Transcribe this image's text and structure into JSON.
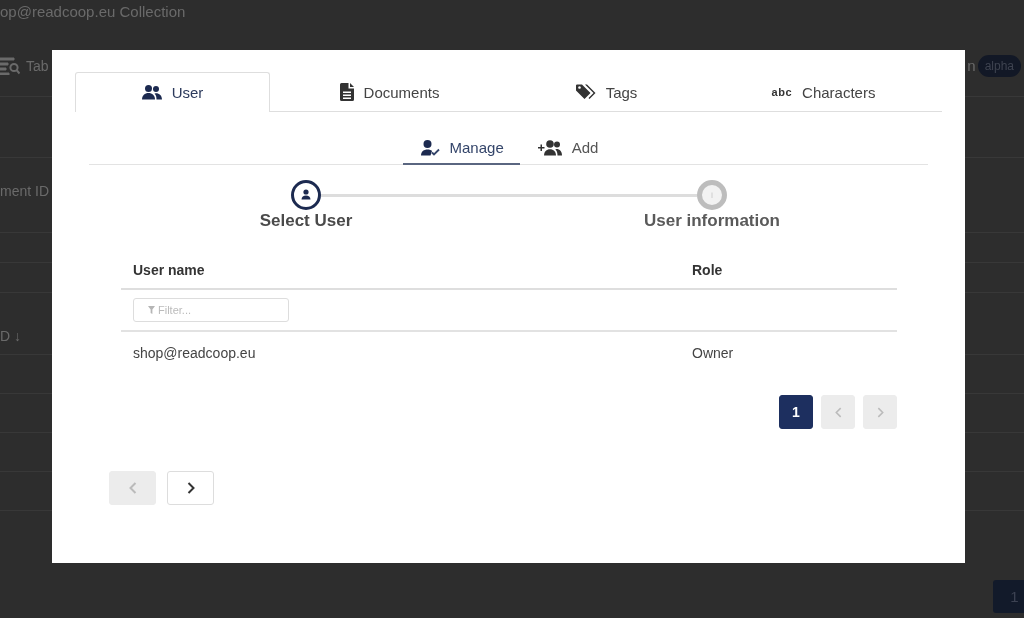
{
  "background": {
    "title": "op@readcoop.eu Collection",
    "toolbar_label": "Tab",
    "badge_caption": "n",
    "badge": "alpha",
    "labels": [
      "ment ID",
      "D ↓"
    ],
    "page_button": {
      "label": "1",
      "selected": true
    }
  },
  "dialog": {
    "tabs": [
      {
        "label": "User",
        "selected": true
      },
      {
        "label": "Documents",
        "selected": false
      },
      {
        "label": "Tags",
        "selected": false
      },
      {
        "label": "Characters",
        "glyph": "abc",
        "selected": false
      }
    ],
    "subtabs": [
      {
        "label": "Manage",
        "selected": true
      },
      {
        "label": "Add",
        "selected": false
      }
    ],
    "steps": [
      {
        "label": "Select User",
        "active": true
      },
      {
        "label": "User information",
        "active": false
      }
    ],
    "table": {
      "columns": [
        "User name",
        "Role"
      ],
      "filter": {
        "placeholder": "Filter..."
      },
      "rows": [
        [
          "shop@readcoop.eu",
          "Owner"
        ]
      ]
    },
    "pagination": {
      "pages": [
        {
          "label": "1",
          "selected": true
        }
      ],
      "previous_disabled": true,
      "next_disabled": true
    },
    "wizard_nav": {
      "back_disabled": true,
      "next_disabled": false
    }
  }
}
